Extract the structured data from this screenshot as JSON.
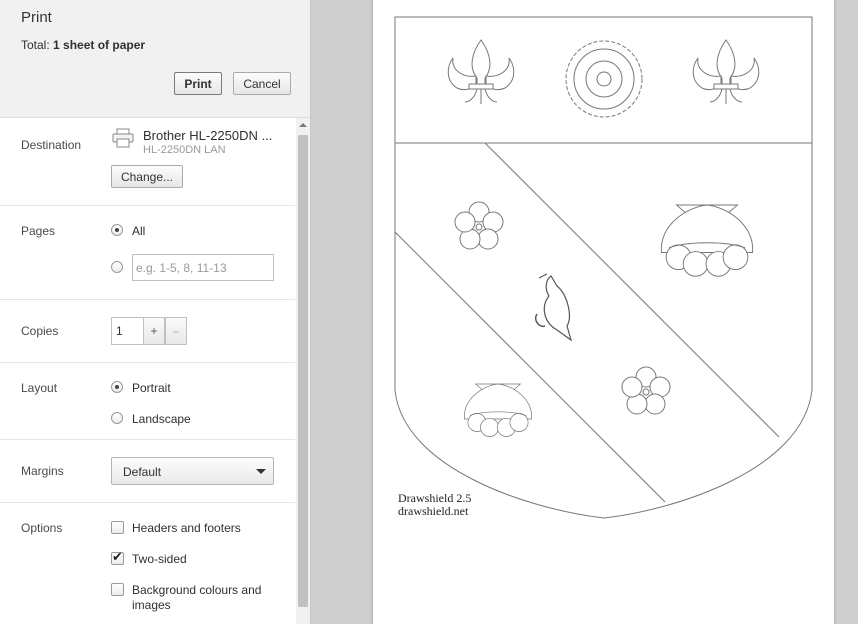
{
  "header": {
    "title": "Print",
    "total_label": "Total:",
    "total_value": "1 sheet of paper",
    "print_label": "Print",
    "cancel_label": "Cancel"
  },
  "destination": {
    "label": "Destination",
    "printer_name": "Brother HL-2250DN ...",
    "printer_sub": "HL-2250DN LAN",
    "change_label": "Change..."
  },
  "pages": {
    "label": "Pages",
    "all_label": "All",
    "selected": "all",
    "range_placeholder": "e.g. 1-5, 8, 11-13"
  },
  "copies": {
    "label": "Copies",
    "value": "1",
    "plus": "+",
    "minus": "–"
  },
  "layout": {
    "label": "Layout",
    "portrait_label": "Portrait",
    "landscape_label": "Landscape",
    "selected": "portrait"
  },
  "margins": {
    "label": "Margins",
    "value": "Default"
  },
  "options": {
    "label": "Options",
    "headers_footers": {
      "label": "Headers and footers",
      "checked": false
    },
    "two_sided": {
      "label": "Two-sided",
      "checked": true
    },
    "background": {
      "label_line1": "Background colours and",
      "label_line2": "images",
      "checked": false
    }
  },
  "preview": {
    "credit_line1": "Drawshield 2.5",
    "credit_line2": "drawshield.net"
  }
}
